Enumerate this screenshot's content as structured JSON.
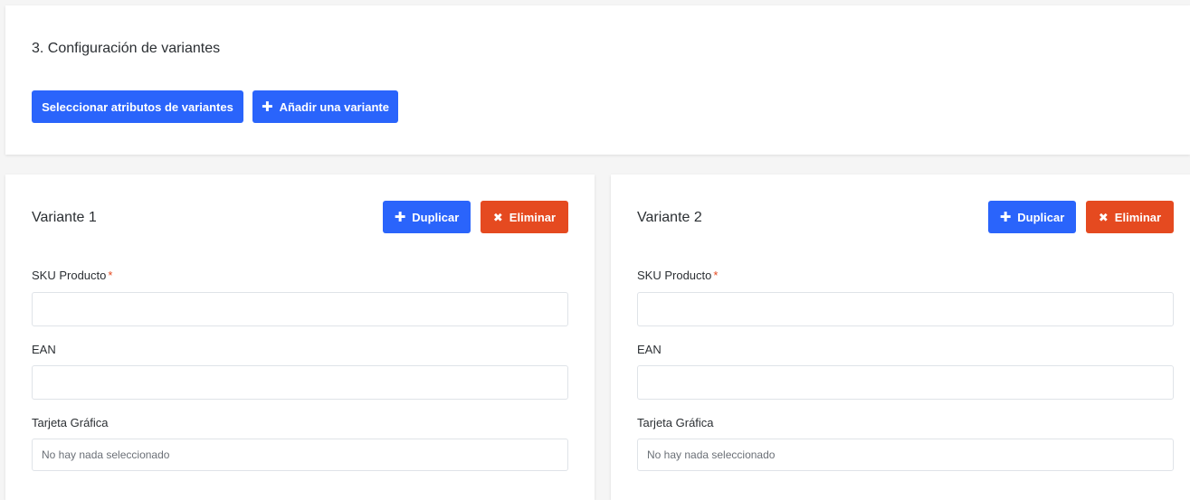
{
  "config_section": {
    "title": "3. Configuración de variantes",
    "select_attributes_label": "Seleccionar atributos de variantes",
    "add_variant_label": "Añadir una variante"
  },
  "variants": [
    {
      "title": "Variante 1",
      "duplicate_label": "Duplicar",
      "delete_label": "Eliminar",
      "sku_label": "SKU Producto",
      "sku_required_mark": "*",
      "sku_value": "",
      "ean_label": "EAN",
      "ean_value": "",
      "graphics_label": "Tarjeta Gráfica",
      "graphics_placeholder": "No hay nada seleccionado"
    },
    {
      "title": "Variante 2",
      "duplicate_label": "Duplicar",
      "delete_label": "Eliminar",
      "sku_label": "SKU Producto",
      "sku_required_mark": "*",
      "sku_value": "",
      "ean_label": "EAN",
      "ean_value": "",
      "graphics_label": "Tarjeta Gráfica",
      "graphics_placeholder": "No hay nada seleccionado"
    }
  ],
  "icons": {
    "plus": "plus-icon",
    "close": "close-icon"
  },
  "colors": {
    "primary": "#2a64fb",
    "danger": "#e54a20",
    "background": "#f5f5f5",
    "card": "#ffffff"
  }
}
